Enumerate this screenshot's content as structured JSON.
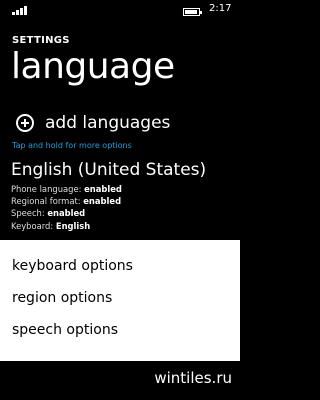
{
  "status_bar": {
    "signal_bars": 4,
    "battery_level": 0.9,
    "time": "2:17"
  },
  "header": {
    "app_title": "SETTINGS",
    "page_title": "language"
  },
  "add_languages": {
    "label": "add languages",
    "icon": "plus-circle-icon"
  },
  "hint": "Tap and hold for more options",
  "language": {
    "name": "English (United States)",
    "phone_language_label": "Phone language:",
    "phone_language_value": "enabled",
    "regional_format_label": "Regional format:",
    "regional_format_value": "enabled",
    "speech_label": "Speech:",
    "speech_value": "enabled",
    "keyboard_label": "Keyboard:",
    "keyboard_value": "English"
  },
  "context_menu": {
    "items": [
      {
        "label": "keyboard options"
      },
      {
        "label": "region options"
      },
      {
        "label": "speech options"
      }
    ]
  },
  "watermark": "wintiles.ru",
  "colors": {
    "background": "#000000",
    "accent": "#1ba1e2",
    "menu_background": "#ffffff"
  }
}
